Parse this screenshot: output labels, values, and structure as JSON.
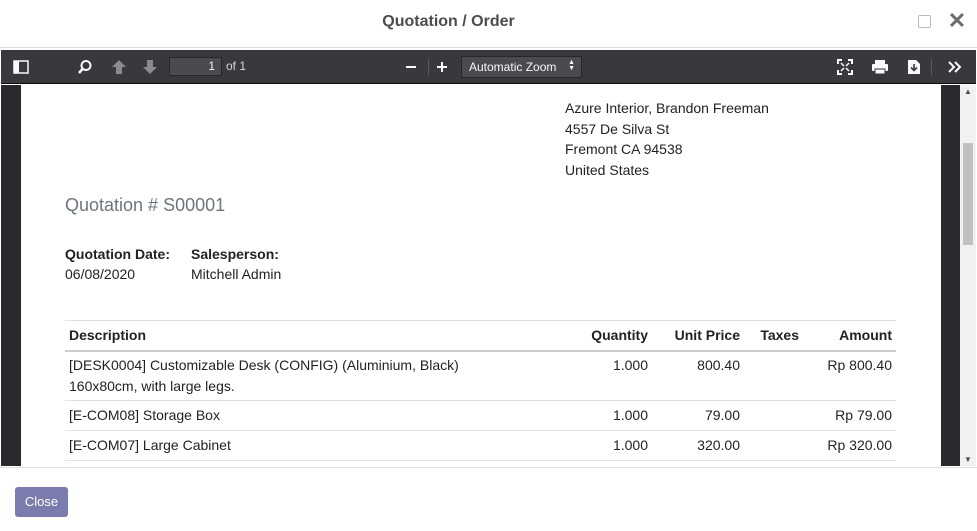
{
  "modal": {
    "title": "Quotation / Order",
    "close_label": "Close"
  },
  "toolbar": {
    "page_number": "1",
    "page_count_label": "of 1",
    "zoom_value": "Automatic Zoom"
  },
  "document": {
    "customer_address": [
      "Azure Interior, Brandon Freeman",
      "4557 De Silva St",
      "Fremont CA 94538",
      "United States"
    ],
    "quotation_title": "Quotation # S00001",
    "quotation_date_label": "Quotation Date:",
    "quotation_date": "06/08/2020",
    "salesperson_label": "Salesperson:",
    "salesperson": "Mitchell Admin",
    "table": {
      "headers": {
        "description": "Description",
        "quantity": "Quantity",
        "unit_price": "Unit Price",
        "taxes": "Taxes",
        "amount": "Amount"
      },
      "rows": [
        {
          "description_line1": "[DESK0004] Customizable Desk (CONFIG) (Aluminium, Black)",
          "description_line2": "160x80cm, with large legs.",
          "quantity": "1.000",
          "unit_price": "800.40",
          "taxes": "",
          "amount": "Rp 800.40"
        },
        {
          "description_line1": "[E-COM08] Storage Box",
          "description_line2": "",
          "quantity": "1.000",
          "unit_price": "79.00",
          "taxes": "",
          "amount": "Rp 79.00"
        },
        {
          "description_line1": "[E-COM07] Large Cabinet",
          "description_line2": "",
          "quantity": "1.000",
          "unit_price": "320.00",
          "taxes": "",
          "amount": "Rp 320.00"
        }
      ]
    }
  },
  "icons": {
    "sidebar": "sidebar-toggle-icon",
    "search": "search-icon",
    "prev": "arrow-up-icon",
    "next": "arrow-down-icon",
    "zoom_out": "minus-icon",
    "zoom_in": "plus-icon",
    "presentation": "fullscreen-icon",
    "print": "print-icon",
    "download": "download-icon",
    "tools": "double-chevron-right-icon"
  },
  "colors": {
    "toolbar_bg": "#38383d",
    "viewer_bg": "#2a2a2e",
    "primary_button": "#7c7bad"
  }
}
